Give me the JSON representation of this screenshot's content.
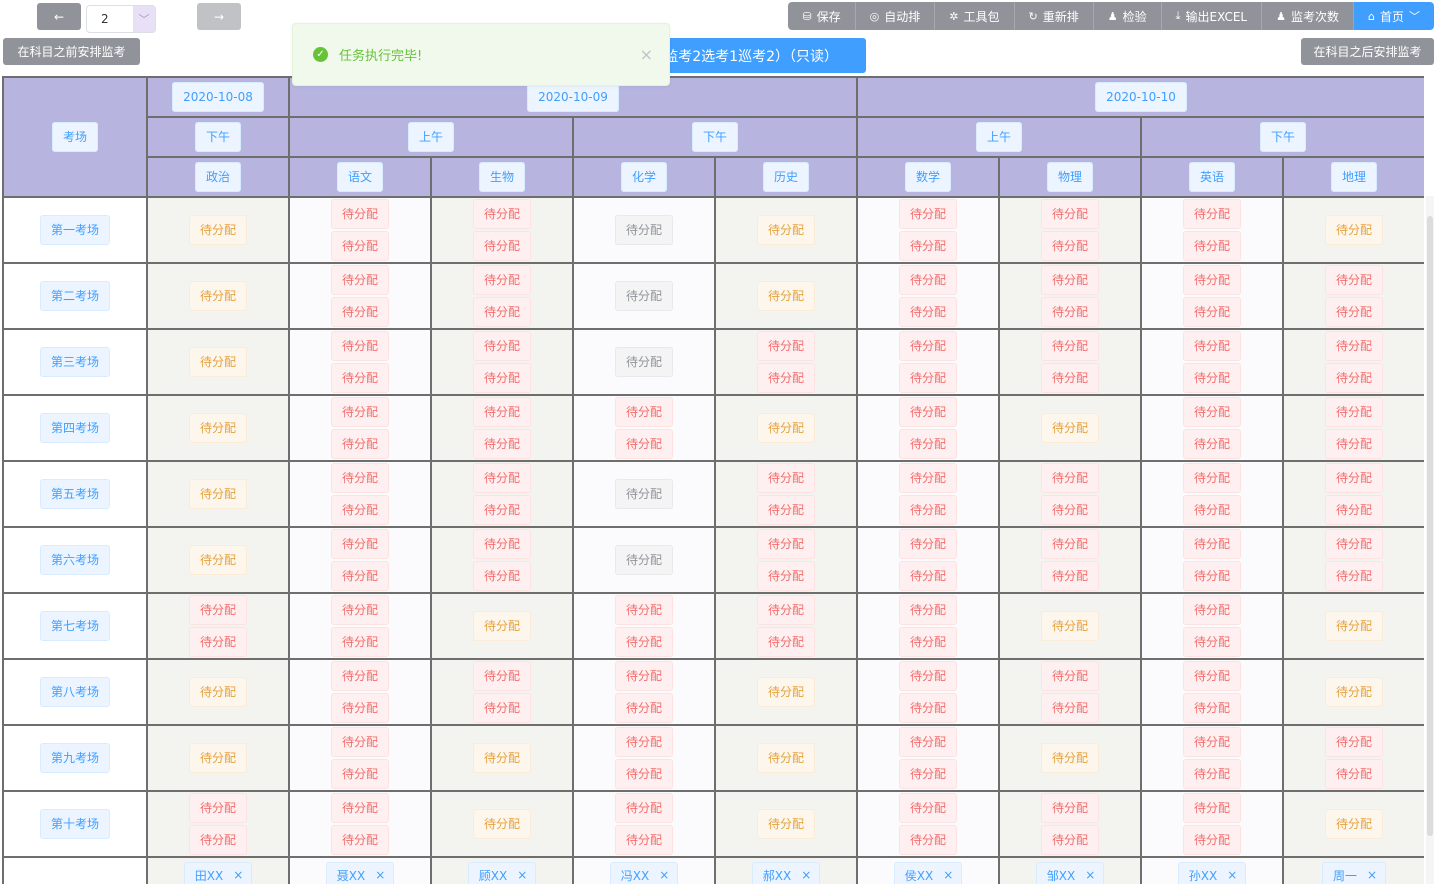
{
  "pager": {
    "prev_icon": "←",
    "next_icon": "→",
    "page_value": "2",
    "dropdown_icon": "﹀"
  },
  "toolbar": {
    "save": {
      "icon": "⛁",
      "label": "保存"
    },
    "auto": {
      "icon": "◎",
      "label": "自动排"
    },
    "tools": {
      "icon": "✲",
      "label": "工具包"
    },
    "rearrange": {
      "icon": "↻",
      "label": "重新排"
    },
    "check": {
      "icon": "♟",
      "label": "检验"
    },
    "export": {
      "icon": "⤓",
      "label": "输出EXCEL"
    },
    "count": {
      "icon": "♟",
      "label": "监考次数"
    },
    "home": {
      "icon": "⌂",
      "label": "首页",
      "caret": "﹀"
    }
  },
  "before_button": "在科目之前安排监考",
  "after_button": "在科目之后安排监考",
  "mode_tab": "监考2选考1巡考2）（只读）",
  "toast": {
    "message": "任务执行完毕!",
    "close": "×",
    "icon": "✓"
  },
  "header": {
    "room_label": "考场",
    "dates": [
      "2020-10-08",
      "2020-10-09",
      "2020-10-10"
    ],
    "sessions": [
      "下午",
      "上午",
      "下午",
      "上午",
      "下午"
    ],
    "subjects": [
      "政治",
      "语文",
      "生物",
      "化学",
      "历史",
      "数学",
      "物理",
      "英语",
      "地理"
    ]
  },
  "tag_text": "待分配",
  "rooms": [
    {
      "name": "第一考场",
      "cells": [
        [
          "w"
        ],
        [
          "d",
          "d"
        ],
        [
          "d",
          "d"
        ],
        [
          "i"
        ],
        [
          "w"
        ],
        [
          "d",
          "d"
        ],
        [
          "d",
          "d"
        ],
        [
          "d",
          "d"
        ],
        [
          "w"
        ]
      ]
    },
    {
      "name": "第二考场",
      "cells": [
        [
          "w"
        ],
        [
          "d",
          "d"
        ],
        [
          "d",
          "d"
        ],
        [
          "i"
        ],
        [
          "w"
        ],
        [
          "d",
          "d"
        ],
        [
          "d",
          "d"
        ],
        [
          "d",
          "d"
        ],
        [
          "d",
          "d"
        ]
      ]
    },
    {
      "name": "第三考场",
      "cells": [
        [
          "w"
        ],
        [
          "d",
          "d"
        ],
        [
          "d",
          "d"
        ],
        [
          "i"
        ],
        [
          "d",
          "d"
        ],
        [
          "d",
          "d"
        ],
        [
          "d",
          "d"
        ],
        [
          "d",
          "d"
        ],
        [
          "d",
          "d"
        ]
      ]
    },
    {
      "name": "第四考场",
      "cells": [
        [
          "w"
        ],
        [
          "d",
          "d"
        ],
        [
          "d",
          "d"
        ],
        [
          "d",
          "d"
        ],
        [
          "w"
        ],
        [
          "d",
          "d"
        ],
        [
          "w"
        ],
        [
          "d",
          "d"
        ],
        [
          "d",
          "d"
        ]
      ]
    },
    {
      "name": "第五考场",
      "cells": [
        [
          "w"
        ],
        [
          "d",
          "d"
        ],
        [
          "d",
          "d"
        ],
        [
          "i"
        ],
        [
          "d",
          "d"
        ],
        [
          "d",
          "d"
        ],
        [
          "d",
          "d"
        ],
        [
          "d",
          "d"
        ],
        [
          "d",
          "d"
        ]
      ]
    },
    {
      "name": "第六考场",
      "cells": [
        [
          "w"
        ],
        [
          "d",
          "d"
        ],
        [
          "d",
          "d"
        ],
        [
          "i"
        ],
        [
          "d",
          "d"
        ],
        [
          "d",
          "d"
        ],
        [
          "d",
          "d"
        ],
        [
          "d",
          "d"
        ],
        [
          "d",
          "d"
        ]
      ]
    },
    {
      "name": "第七考场",
      "cells": [
        [
          "d",
          "d"
        ],
        [
          "d",
          "d"
        ],
        [
          "w"
        ],
        [
          "d",
          "d"
        ],
        [
          "d",
          "d"
        ],
        [
          "d",
          "d"
        ],
        [
          "w"
        ],
        [
          "d",
          "d"
        ],
        [
          "w"
        ]
      ]
    },
    {
      "name": "第八考场",
      "cells": [
        [
          "w"
        ],
        [
          "d",
          "d"
        ],
        [
          "d",
          "d"
        ],
        [
          "d",
          "d"
        ],
        [
          "w"
        ],
        [
          "d",
          "d"
        ],
        [
          "d",
          "d"
        ],
        [
          "d",
          "d"
        ],
        [
          "w"
        ]
      ]
    },
    {
      "name": "第九考场",
      "cells": [
        [
          "w"
        ],
        [
          "d",
          "d"
        ],
        [
          "w"
        ],
        [
          "d",
          "d"
        ],
        [
          "w"
        ],
        [
          "d",
          "d"
        ],
        [
          "w"
        ],
        [
          "d",
          "d"
        ],
        [
          "d",
          "d"
        ]
      ]
    },
    {
      "name": "第十考场",
      "cells": [
        [
          "d",
          "d"
        ],
        [
          "d",
          "d"
        ],
        [
          "w"
        ],
        [
          "d",
          "d"
        ],
        [
          "w"
        ],
        [
          "d",
          "d"
        ],
        [
          "d",
          "d"
        ],
        [
          "d",
          "d"
        ],
        [
          "w"
        ]
      ]
    }
  ],
  "teachers": [
    "田XX",
    "聂XX",
    "顾XX",
    "冯XX",
    "郝XX",
    "侯XX",
    "邹XX",
    "孙XX",
    "周一"
  ],
  "remove_icon": "×"
}
